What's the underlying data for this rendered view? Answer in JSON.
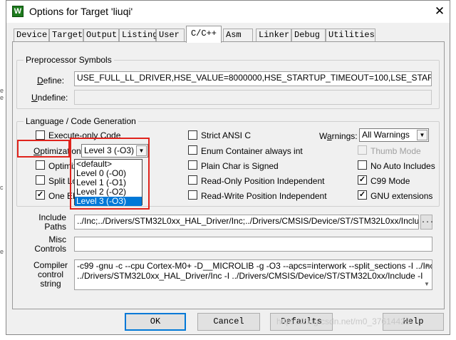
{
  "window": {
    "title": "Options for Target 'liuqi'",
    "icon_letter": "W",
    "close_glyph": "✕"
  },
  "tabs": [
    "Device",
    "Target",
    "Output",
    "Listing",
    "User",
    "C/C++",
    "Asm",
    "Linker",
    "Debug",
    "Utilities"
  ],
  "active_tab": "C/C++",
  "preprocessor": {
    "group_label": "Preprocessor Symbols",
    "define_label": "Define:",
    "define_value": "USE_FULL_LL_DRIVER,HSE_VALUE=8000000,HSE_STARTUP_TIMEOUT=100,LSE_STARTUP_TIM",
    "undefine_label": "Undefine:",
    "undefine_value": ""
  },
  "language": {
    "group_label": "Language / Code Generation",
    "execute_only": {
      "label": "Execute-only Code",
      "checked": false
    },
    "optimization_label": "Optimization:",
    "optimization_value": "Level 3 (-O3)",
    "optimize_time": {
      "label": "Optimize",
      "checked": false
    },
    "split_load": {
      "label": "Split Load",
      "checked": false
    },
    "one_elf": {
      "label": "One ELF",
      "checked": true
    },
    "optimization_options": [
      "<default>",
      "Level 0 (-O0)",
      "Level 1 (-O1)",
      "Level 2 (-O2)",
      "Level 3 (-O3)"
    ],
    "selected_option": "Level 3 (-O3)",
    "strict_ansi": {
      "label": "Strict ANSI C",
      "checked": false
    },
    "enum_container": {
      "label": "Enum Container always int",
      "checked": false
    },
    "plain_char": {
      "label": "Plain Char is Signed",
      "checked": false
    },
    "ropi": {
      "label": "Read-Only Position Independent",
      "checked": false
    },
    "rwpi": {
      "label": "Read-Write Position Independent",
      "checked": false
    },
    "warnings_label": "Warnings:",
    "warnings_value": "All Warnings",
    "thumb_mode": {
      "label": "Thumb Mode",
      "checked": false,
      "disabled": true
    },
    "no_auto_includes": {
      "label": "No Auto Includes",
      "checked": false
    },
    "c99_mode": {
      "label": "C99 Mode",
      "checked": true
    },
    "gnu_extensions": {
      "label": "GNU extensions",
      "checked": true
    }
  },
  "include_paths": {
    "label": "Include Paths",
    "value": "../Inc;../Drivers/STM32L0xx_HAL_Driver/Inc;../Drivers/CMSIS/Device/ST/STM32L0xx/Include;../I",
    "browse": "..."
  },
  "misc_controls": {
    "label": "Misc Controls",
    "value": ""
  },
  "compiler_string": {
    "label": "Compiler control string",
    "line1": "-c99 -gnu -c --cpu Cortex-M0+ -D__MICROLIB -g -O3 --apcs=interwork --split_sections -I ../Inc -I",
    "line2": "../Drivers/STM32L0xx_HAL_Driver/Inc -I ../Drivers/CMSIS/Device/ST/STM32L0xx/Include -I"
  },
  "buttons": {
    "ok": "OK",
    "cancel": "Cancel",
    "defaults": "Defaults",
    "help": "Help"
  },
  "watermark": "https://blog.csdn.net/m0_37614428",
  "checkmark": "✓",
  "scroll_up": "▲",
  "scroll_down": "▼",
  "dropdown_arrow": "▼"
}
